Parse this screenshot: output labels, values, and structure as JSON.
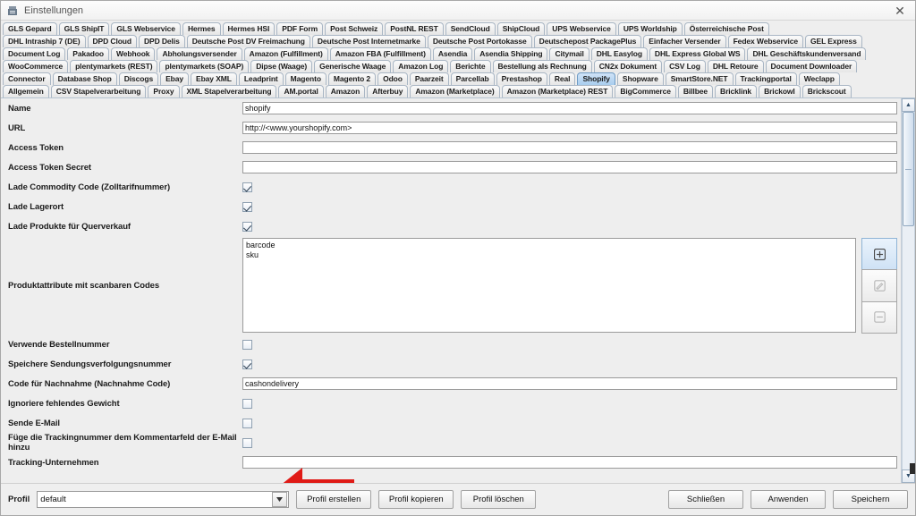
{
  "window": {
    "title": "Einstellungen",
    "app_icon": "app-icon",
    "close_label": "✕"
  },
  "tabs": {
    "rows": [
      [
        {
          "label": "GLS Gepard",
          "selected": false
        },
        {
          "label": "GLS ShipIT",
          "selected": false
        },
        {
          "label": "GLS Webservice",
          "selected": false
        },
        {
          "label": "Hermes",
          "selected": false
        },
        {
          "label": "Hermes HSI",
          "selected": false
        },
        {
          "label": "PDF Form",
          "selected": false
        },
        {
          "label": "Post Schweiz",
          "selected": false
        },
        {
          "label": "PostNL REST",
          "selected": false
        },
        {
          "label": "SendCloud",
          "selected": false
        },
        {
          "label": "ShipCloud",
          "selected": false
        },
        {
          "label": "UPS Webservice",
          "selected": false
        },
        {
          "label": "UPS Worldship",
          "selected": false
        },
        {
          "label": "Österreichische Post",
          "selected": false
        }
      ],
      [
        {
          "label": "DHL Intraship 7 (DE)",
          "selected": false
        },
        {
          "label": "DPD Cloud",
          "selected": false
        },
        {
          "label": "DPD Delis",
          "selected": false
        },
        {
          "label": "Deutsche Post DV Freimachung",
          "selected": false
        },
        {
          "label": "Deutsche Post Internetmarke",
          "selected": false
        },
        {
          "label": "Deutsche Post Portokasse",
          "selected": false
        },
        {
          "label": "Deutschepost PackagePlus",
          "selected": false
        },
        {
          "label": "Einfacher Versender",
          "selected": false
        },
        {
          "label": "Fedex Webservice",
          "selected": false
        },
        {
          "label": "GEL Express",
          "selected": false
        }
      ],
      [
        {
          "label": "Document Log",
          "selected": false
        },
        {
          "label": "Pakadoo",
          "selected": false
        },
        {
          "label": "Webhook",
          "selected": false
        },
        {
          "label": "Abholungsversender",
          "selected": false
        },
        {
          "label": "Amazon (Fulfillment)",
          "selected": false
        },
        {
          "label": "Amazon FBA (Fulfillment)",
          "selected": false
        },
        {
          "label": "Asendia",
          "selected": false
        },
        {
          "label": "Asendia Shipping",
          "selected": false
        },
        {
          "label": "Citymail",
          "selected": false
        },
        {
          "label": "DHL Easylog",
          "selected": false
        },
        {
          "label": "DHL Express Global WS",
          "selected": false
        },
        {
          "label": "DHL Geschäftskundenversand",
          "selected": false
        }
      ],
      [
        {
          "label": "WooCommerce",
          "selected": false
        },
        {
          "label": "plentymarkets (REST)",
          "selected": false
        },
        {
          "label": "plentymarkets (SOAP)",
          "selected": false
        },
        {
          "label": "Dipse (Waage)",
          "selected": false
        },
        {
          "label": "Generische Waage",
          "selected": false
        },
        {
          "label": "Amazon Log",
          "selected": false
        },
        {
          "label": "Berichte",
          "selected": false
        },
        {
          "label": "Bestellung als Rechnung",
          "selected": false
        },
        {
          "label": "CN2x Dokument",
          "selected": false
        },
        {
          "label": "CSV Log",
          "selected": false
        },
        {
          "label": "DHL Retoure",
          "selected": false
        },
        {
          "label": "Document Downloader",
          "selected": false
        }
      ],
      [
        {
          "label": "Connector",
          "selected": false
        },
        {
          "label": "Database Shop",
          "selected": false
        },
        {
          "label": "Discogs",
          "selected": false
        },
        {
          "label": "Ebay",
          "selected": false
        },
        {
          "label": "Ebay XML",
          "selected": false
        },
        {
          "label": "Leadprint",
          "selected": false
        },
        {
          "label": "Magento",
          "selected": false
        },
        {
          "label": "Magento 2",
          "selected": false
        },
        {
          "label": "Odoo",
          "selected": false
        },
        {
          "label": "Paarzeit",
          "selected": false
        },
        {
          "label": "Parcellab",
          "selected": false
        },
        {
          "label": "Prestashop",
          "selected": false
        },
        {
          "label": "Real",
          "selected": false
        },
        {
          "label": "Shopify",
          "selected": true
        },
        {
          "label": "Shopware",
          "selected": false
        },
        {
          "label": "SmartStore.NET",
          "selected": false
        },
        {
          "label": "Trackingportal",
          "selected": false
        },
        {
          "label": "Weclapp",
          "selected": false
        }
      ],
      [
        {
          "label": "Allgemein",
          "selected": false
        },
        {
          "label": "CSV Stapelverarbeitung",
          "selected": false
        },
        {
          "label": "Proxy",
          "selected": false
        },
        {
          "label": "XML Stapelverarbeitung",
          "selected": false
        },
        {
          "label": "AM.portal",
          "selected": false
        },
        {
          "label": "Amazon",
          "selected": false
        },
        {
          "label": "Afterbuy",
          "selected": false
        },
        {
          "label": "Amazon (Marketplace)",
          "selected": false
        },
        {
          "label": "Amazon (Marketplace) REST",
          "selected": false
        },
        {
          "label": "BigCommerce",
          "selected": false
        },
        {
          "label": "Billbee",
          "selected": false
        },
        {
          "label": "Bricklink",
          "selected": false
        },
        {
          "label": "Brickowl",
          "selected": false
        },
        {
          "label": "Brickscout",
          "selected": false
        }
      ]
    ]
  },
  "form": {
    "name": {
      "label": "Name",
      "value": "shopify"
    },
    "url": {
      "label": "URL",
      "value": "http://<www.yourshopify.com>"
    },
    "access_token": {
      "label": "Access Token",
      "value": ""
    },
    "access_token_secret": {
      "label": "Access Token Secret",
      "value": ""
    },
    "commodity_code": {
      "label": "Lade Commodity Code (Zolltarifnummer)",
      "checked": true
    },
    "lagerort": {
      "label": "Lade Lagerort",
      "checked": true
    },
    "querverkauf": {
      "label": "Lade Produkte für Querverkauf",
      "checked": true
    },
    "scan_codes": {
      "label": "Produktattribute mit scanbaren Codes",
      "items": [
        "barcode",
        "sku"
      ],
      "buttons": [
        {
          "name": "add-attribute-button",
          "icon": "plus-icon"
        },
        {
          "name": "edit-attribute-button",
          "icon": "pencil-icon"
        },
        {
          "name": "remove-attribute-button",
          "icon": "minus-icon"
        }
      ]
    },
    "bestellnummer": {
      "label": "Verwende Bestellnummer",
      "checked": false
    },
    "sendungsverfolgung": {
      "label": "Speichere Sendungsverfolgungsnummer",
      "checked": true
    },
    "nachnahme_code": {
      "label": "Code für Nachnahme (Nachnahme Code)",
      "value": "cashondelivery"
    },
    "gewicht": {
      "label": "Ignoriere fehlendes Gewicht",
      "checked": false
    },
    "email": {
      "label": "Sende E-Mail",
      "checked": false
    },
    "trackingnummer_kommentar": {
      "label": "Füge die Trackingnummer dem Kommentarfeld der E-Mail hinzu",
      "checked": false
    },
    "tracking_unternehmen": {
      "label": "Tracking-Unternehmen",
      "value": ""
    }
  },
  "footer": {
    "profile_label": "Profil",
    "profile_value": "default",
    "profile_arrow": "▼",
    "create_label": "Profil erstellen",
    "copy_label": "Profil kopieren",
    "delete_label": "Profil löschen",
    "close_label": "Schließen",
    "apply_label": "Anwenden",
    "save_label": "Speichern"
  },
  "annotation": {
    "arrow_color": "#e01b17",
    "arrow_name": "red-pointer-arrow"
  },
  "scrollbar": {
    "up_arrow": "▲",
    "down_arrow": "▼"
  }
}
